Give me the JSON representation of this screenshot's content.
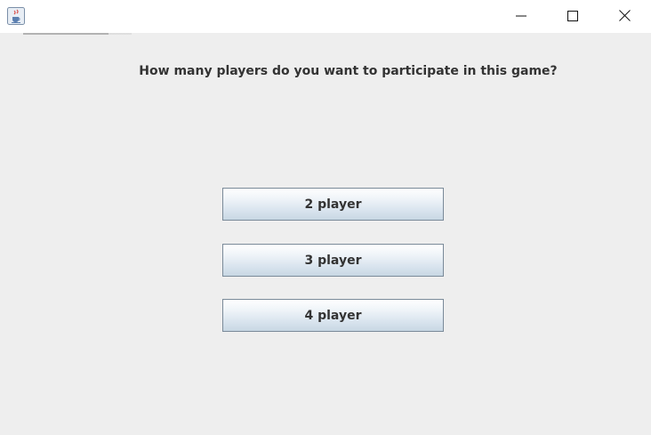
{
  "titlebar": {
    "icon": "java-cup-icon",
    "controls": {
      "minimize_icon": "minimize-icon",
      "maximize_icon": "maximize-icon",
      "close_icon": "close-icon"
    }
  },
  "prompt": {
    "question": "How many players do you want to participate in this game?"
  },
  "player_options": [
    {
      "label": "2 player"
    },
    {
      "label": "3 player"
    },
    {
      "label": "4 player"
    }
  ],
  "colors": {
    "background": "#eeeeee",
    "titlebar": "#ffffff",
    "text": "#333333",
    "button_border": "#7a8a99",
    "button_gradient_top": "#ffffff",
    "button_gradient_bottom": "#c8d7e4"
  }
}
